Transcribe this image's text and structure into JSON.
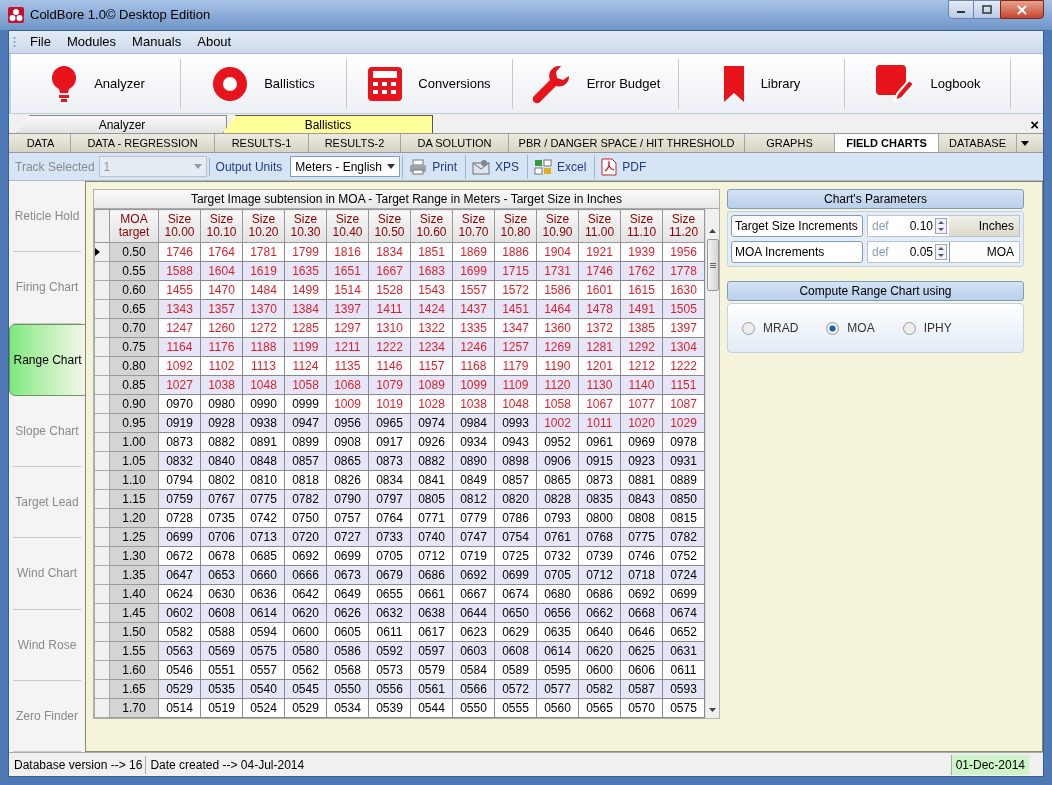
{
  "window": {
    "title": "ColdBore 1.0© Desktop Edition"
  },
  "menu": [
    "File",
    "Modules",
    "Manuals",
    "About"
  ],
  "modules": [
    {
      "label": "Analyzer",
      "kind": "bulb"
    },
    {
      "label": "Ballistics",
      "kind": "target"
    },
    {
      "label": "Conversions",
      "kind": "calculator"
    },
    {
      "label": "Error Budget",
      "kind": "wrench"
    },
    {
      "label": "Library",
      "kind": "bookmark"
    },
    {
      "label": "Logbook",
      "kind": "edit"
    }
  ],
  "module_tabs": [
    {
      "label": "Analyzer",
      "selected": false
    },
    {
      "label": "Ballistics",
      "selected": true
    }
  ],
  "close_glyph": "×",
  "sub_tabs": [
    {
      "label": "DATA",
      "selected": false
    },
    {
      "label": "DATA - REGRESSION",
      "selected": false
    },
    {
      "label": "RESULTS-1",
      "selected": false
    },
    {
      "label": "RESULTS-2",
      "selected": false
    },
    {
      "label": "DA SOLUTION",
      "selected": false
    },
    {
      "label": "PBR / DANGER SPACE / HIT THRESHOLD",
      "selected": false
    },
    {
      "label": "GRAPHS",
      "selected": false
    },
    {
      "label": "FIELD CHARTS",
      "selected": true
    },
    {
      "label": "DATABASE",
      "selected": false
    }
  ],
  "options": {
    "track_label": "Track Selected",
    "track_value": "1",
    "track_disabled": true,
    "units_label": "Output Units",
    "units_value": "Meters - English",
    "exports": [
      {
        "label": "Print",
        "kind": "print"
      },
      {
        "label": "XPS",
        "kind": "xps"
      },
      {
        "label": "Excel",
        "kind": "excel"
      },
      {
        "label": "PDF",
        "kind": "pdf"
      }
    ]
  },
  "side_tabs": [
    {
      "label": "Reticle Hold",
      "selected": false
    },
    {
      "label": "Firing Chart",
      "selected": false
    },
    {
      "label": "Range Chart",
      "selected": true
    },
    {
      "label": "Slope Chart",
      "selected": false
    },
    {
      "label": "Target Lead",
      "selected": false
    },
    {
      "label": "Wind Chart",
      "selected": false
    },
    {
      "label": "Wind Rose",
      "selected": false
    },
    {
      "label": "Zero Finder",
      "selected": false
    }
  ],
  "table": {
    "title": "Target Image subtension in MOA - Target Range in Meters - Target Size in Inches",
    "columns": [
      "MOA target",
      "Size 10.00",
      "Size 10.10",
      "Size 10.20",
      "Size 10.30",
      "Size 10.40",
      "Size 10.50",
      "Size 10.60",
      "Size 10.70",
      "Size 10.80",
      "Size 10.90",
      "Size 11.00",
      "Size 11.10",
      "Size 11.20"
    ],
    "rows": [
      {
        "moa": "0.50",
        "selected": true,
        "values": [
          "1746",
          "1764",
          "1781",
          "1799",
          "1816",
          "1834",
          "1851",
          "1869",
          "1886",
          "1904",
          "1921",
          "1939",
          "1956"
        ],
        "flagged": [
          true,
          true,
          true,
          true,
          true,
          true,
          true,
          true,
          true,
          true,
          true,
          true,
          true
        ]
      },
      {
        "moa": "0.55",
        "selected": false,
        "values": [
          "1588",
          "1604",
          "1619",
          "1635",
          "1651",
          "1667",
          "1683",
          "1699",
          "1715",
          "1731",
          "1746",
          "1762",
          "1778"
        ],
        "flagged": [
          true,
          true,
          true,
          true,
          true,
          true,
          true,
          true,
          true,
          true,
          true,
          true,
          true
        ]
      },
      {
        "moa": "0.60",
        "selected": false,
        "values": [
          "1455",
          "1470",
          "1484",
          "1499",
          "1514",
          "1528",
          "1543",
          "1557",
          "1572",
          "1586",
          "1601",
          "1615",
          "1630"
        ],
        "flagged": [
          true,
          true,
          true,
          true,
          true,
          true,
          true,
          true,
          true,
          true,
          true,
          true,
          true
        ]
      },
      {
        "moa": "0.65",
        "selected": false,
        "values": [
          "1343",
          "1357",
          "1370",
          "1384",
          "1397",
          "1411",
          "1424",
          "1437",
          "1451",
          "1464",
          "1478",
          "1491",
          "1505"
        ],
        "flagged": [
          true,
          true,
          true,
          true,
          true,
          true,
          true,
          true,
          true,
          true,
          true,
          true,
          true
        ]
      },
      {
        "moa": "0.70",
        "selected": false,
        "values": [
          "1247",
          "1260",
          "1272",
          "1285",
          "1297",
          "1310",
          "1322",
          "1335",
          "1347",
          "1360",
          "1372",
          "1385",
          "1397"
        ],
        "flagged": [
          true,
          true,
          true,
          true,
          true,
          true,
          true,
          true,
          true,
          true,
          true,
          true,
          true
        ]
      },
      {
        "moa": "0.75",
        "selected": false,
        "values": [
          "1164",
          "1176",
          "1188",
          "1199",
          "1211",
          "1222",
          "1234",
          "1246",
          "1257",
          "1269",
          "1281",
          "1292",
          "1304"
        ],
        "flagged": [
          true,
          true,
          true,
          true,
          true,
          true,
          true,
          true,
          true,
          true,
          true,
          true,
          true
        ]
      },
      {
        "moa": "0.80",
        "selected": false,
        "values": [
          "1092",
          "1102",
          "1113",
          "1124",
          "1135",
          "1146",
          "1157",
          "1168",
          "1179",
          "1190",
          "1201",
          "1212",
          "1222"
        ],
        "flagged": [
          true,
          true,
          true,
          true,
          true,
          true,
          true,
          true,
          true,
          true,
          true,
          true,
          true
        ]
      },
      {
        "moa": "0.85",
        "selected": false,
        "values": [
          "1027",
          "1038",
          "1048",
          "1058",
          "1068",
          "1079",
          "1089",
          "1099",
          "1109",
          "1120",
          "1130",
          "1140",
          "1151"
        ],
        "flagged": [
          true,
          true,
          true,
          true,
          true,
          true,
          true,
          true,
          true,
          true,
          true,
          true,
          true
        ]
      },
      {
        "moa": "0.90",
        "selected": false,
        "values": [
          "0970",
          "0980",
          "0990",
          "0999",
          "1009",
          "1019",
          "1028",
          "1038",
          "1048",
          "1058",
          "1067",
          "1077",
          "1087"
        ],
        "flagged": [
          false,
          false,
          false,
          false,
          true,
          true,
          true,
          true,
          true,
          true,
          true,
          true,
          true
        ]
      },
      {
        "moa": "0.95",
        "selected": false,
        "values": [
          "0919",
          "0928",
          "0938",
          "0947",
          "0956",
          "0965",
          "0974",
          "0984",
          "0993",
          "1002",
          "1011",
          "1020",
          "1029"
        ],
        "flagged": [
          false,
          false,
          false,
          false,
          false,
          false,
          false,
          false,
          false,
          true,
          true,
          true,
          true
        ]
      },
      {
        "moa": "1.00",
        "selected": false,
        "values": [
          "0873",
          "0882",
          "0891",
          "0899",
          "0908",
          "0917",
          "0926",
          "0934",
          "0943",
          "0952",
          "0961",
          "0969",
          "0978"
        ],
        "flagged": [
          false,
          false,
          false,
          false,
          false,
          false,
          false,
          false,
          false,
          false,
          false,
          false,
          false
        ]
      },
      {
        "moa": "1.05",
        "selected": false,
        "values": [
          "0832",
          "0840",
          "0848",
          "0857",
          "0865",
          "0873",
          "0882",
          "0890",
          "0898",
          "0906",
          "0915",
          "0923",
          "0931"
        ],
        "flagged": [
          false,
          false,
          false,
          false,
          false,
          false,
          false,
          false,
          false,
          false,
          false,
          false,
          false
        ]
      },
      {
        "moa": "1.10",
        "selected": false,
        "values": [
          "0794",
          "0802",
          "0810",
          "0818",
          "0826",
          "0834",
          "0841",
          "0849",
          "0857",
          "0865",
          "0873",
          "0881",
          "0889"
        ],
        "flagged": [
          false,
          false,
          false,
          false,
          false,
          false,
          false,
          false,
          false,
          false,
          false,
          false,
          false
        ]
      },
      {
        "moa": "1.15",
        "selected": false,
        "values": [
          "0759",
          "0767",
          "0775",
          "0782",
          "0790",
          "0797",
          "0805",
          "0812",
          "0820",
          "0828",
          "0835",
          "0843",
          "0850"
        ],
        "flagged": [
          false,
          false,
          false,
          false,
          false,
          false,
          false,
          false,
          false,
          false,
          false,
          false,
          false
        ]
      },
      {
        "moa": "1.20",
        "selected": false,
        "values": [
          "0728",
          "0735",
          "0742",
          "0750",
          "0757",
          "0764",
          "0771",
          "0779",
          "0786",
          "0793",
          "0800",
          "0808",
          "0815"
        ],
        "flagged": [
          false,
          false,
          false,
          false,
          false,
          false,
          false,
          false,
          false,
          false,
          false,
          false,
          false
        ]
      },
      {
        "moa": "1.25",
        "selected": false,
        "values": [
          "0699",
          "0706",
          "0713",
          "0720",
          "0727",
          "0733",
          "0740",
          "0747",
          "0754",
          "0761",
          "0768",
          "0775",
          "0782"
        ],
        "flagged": [
          false,
          false,
          false,
          false,
          false,
          false,
          false,
          false,
          false,
          false,
          false,
          false,
          false
        ]
      },
      {
        "moa": "1.30",
        "selected": false,
        "values": [
          "0672",
          "0678",
          "0685",
          "0692",
          "0699",
          "0705",
          "0712",
          "0719",
          "0725",
          "0732",
          "0739",
          "0746",
          "0752"
        ],
        "flagged": [
          false,
          false,
          false,
          false,
          false,
          false,
          false,
          false,
          false,
          false,
          false,
          false,
          false
        ]
      },
      {
        "moa": "1.35",
        "selected": false,
        "values": [
          "0647",
          "0653",
          "0660",
          "0666",
          "0673",
          "0679",
          "0686",
          "0692",
          "0699",
          "0705",
          "0712",
          "0718",
          "0724"
        ],
        "flagged": [
          false,
          false,
          false,
          false,
          false,
          false,
          false,
          false,
          false,
          false,
          false,
          false,
          false
        ]
      },
      {
        "moa": "1.40",
        "selected": false,
        "values": [
          "0624",
          "0630",
          "0636",
          "0642",
          "0649",
          "0655",
          "0661",
          "0667",
          "0674",
          "0680",
          "0686",
          "0692",
          "0699"
        ],
        "flagged": [
          false,
          false,
          false,
          false,
          false,
          false,
          false,
          false,
          false,
          false,
          false,
          false,
          false
        ]
      },
      {
        "moa": "1.45",
        "selected": false,
        "values": [
          "0602",
          "0608",
          "0614",
          "0620",
          "0626",
          "0632",
          "0638",
          "0644",
          "0650",
          "0656",
          "0662",
          "0668",
          "0674"
        ],
        "flagged": [
          false,
          false,
          false,
          false,
          false,
          false,
          false,
          false,
          false,
          false,
          false,
          false,
          false
        ]
      },
      {
        "moa": "1.50",
        "selected": false,
        "values": [
          "0582",
          "0588",
          "0594",
          "0600",
          "0605",
          "0611",
          "0617",
          "0623",
          "0629",
          "0635",
          "0640",
          "0646",
          "0652"
        ],
        "flagged": [
          false,
          false,
          false,
          false,
          false,
          false,
          false,
          false,
          false,
          false,
          false,
          false,
          false
        ]
      },
      {
        "moa": "1.55",
        "selected": false,
        "values": [
          "0563",
          "0569",
          "0575",
          "0580",
          "0586",
          "0592",
          "0597",
          "0603",
          "0608",
          "0614",
          "0620",
          "0625",
          "0631"
        ],
        "flagged": [
          false,
          false,
          false,
          false,
          false,
          false,
          false,
          false,
          false,
          false,
          false,
          false,
          false
        ]
      },
      {
        "moa": "1.60",
        "selected": false,
        "values": [
          "0546",
          "0551",
          "0557",
          "0562",
          "0568",
          "0573",
          "0579",
          "0584",
          "0589",
          "0595",
          "0600",
          "0606",
          "0611"
        ],
        "flagged": [
          false,
          false,
          false,
          false,
          false,
          false,
          false,
          false,
          false,
          false,
          false,
          false,
          false
        ]
      },
      {
        "moa": "1.65",
        "selected": false,
        "values": [
          "0529",
          "0535",
          "0540",
          "0545",
          "0550",
          "0556",
          "0561",
          "0566",
          "0572",
          "0577",
          "0582",
          "0587",
          "0593"
        ],
        "flagged": [
          false,
          false,
          false,
          false,
          false,
          false,
          false,
          false,
          false,
          false,
          false,
          false,
          false
        ]
      },
      {
        "moa": "1.70",
        "selected": false,
        "values": [
          "0514",
          "0519",
          "0524",
          "0529",
          "0534",
          "0539",
          "0544",
          "0550",
          "0555",
          "0560",
          "0565",
          "0570",
          "0575"
        ],
        "flagged": [
          false,
          false,
          false,
          false,
          false,
          false,
          false,
          false,
          false,
          false,
          false,
          false,
          false
        ]
      }
    ]
  },
  "parameters": {
    "title": "Chart's Parameters",
    "rows": [
      {
        "label": "Target Size Increments",
        "hint": "def",
        "value": "0.10",
        "unit": "Inches",
        "kind": "button"
      },
      {
        "label": "MOA Increments",
        "hint": "def",
        "value": "0.05",
        "unit": "MOA",
        "kind": "plain"
      }
    ]
  },
  "compute": {
    "title": "Compute Range Chart using",
    "options": [
      {
        "label": "MRAD",
        "selected": false
      },
      {
        "label": "MOA",
        "selected": true
      },
      {
        "label": "IPHY",
        "selected": false
      }
    ]
  },
  "status_bar": {
    "db_version": "Database version --> 16",
    "date_created": "Date created --> 04-Jul-2014",
    "date": "01-Dec-2014"
  }
}
